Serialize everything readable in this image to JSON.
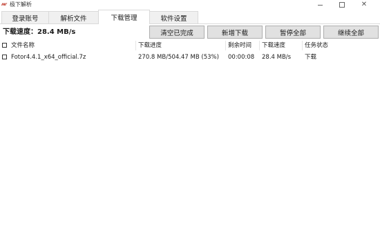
{
  "window": {
    "title": "极下解析",
    "icon": "app-logo-icon",
    "icon_glyph": "ʍr",
    "controls": {
      "minimize": "minimize-icon",
      "maximize": "maximize-icon",
      "close": "✕"
    }
  },
  "tabs": [
    {
      "label": "登录账号",
      "active": false
    },
    {
      "label": "解析文件",
      "active": false
    },
    {
      "label": "下载管理",
      "active": true
    },
    {
      "label": "软件设置",
      "active": false
    }
  ],
  "toolbar": {
    "speed_text": "下载速度：28.4 MB/s",
    "clear_label": "清空已完成",
    "new_label": "新增下载",
    "pause_label": "暂停全部",
    "resume_label": "继续全部"
  },
  "list": {
    "columns": {
      "name": "文件名称",
      "progress": "下载进度",
      "remaining": "剩余时间",
      "speed": "下载速度",
      "status": "任务状态"
    },
    "rows": [
      {
        "checked": false,
        "name": "Fotor4.4.1_x64_official.7z",
        "progress": "270.8 MB/504.47 MB (53%)",
        "remaining": "00:00:08",
        "speed": "28.4 MB/s",
        "status": "下载"
      }
    ]
  }
}
